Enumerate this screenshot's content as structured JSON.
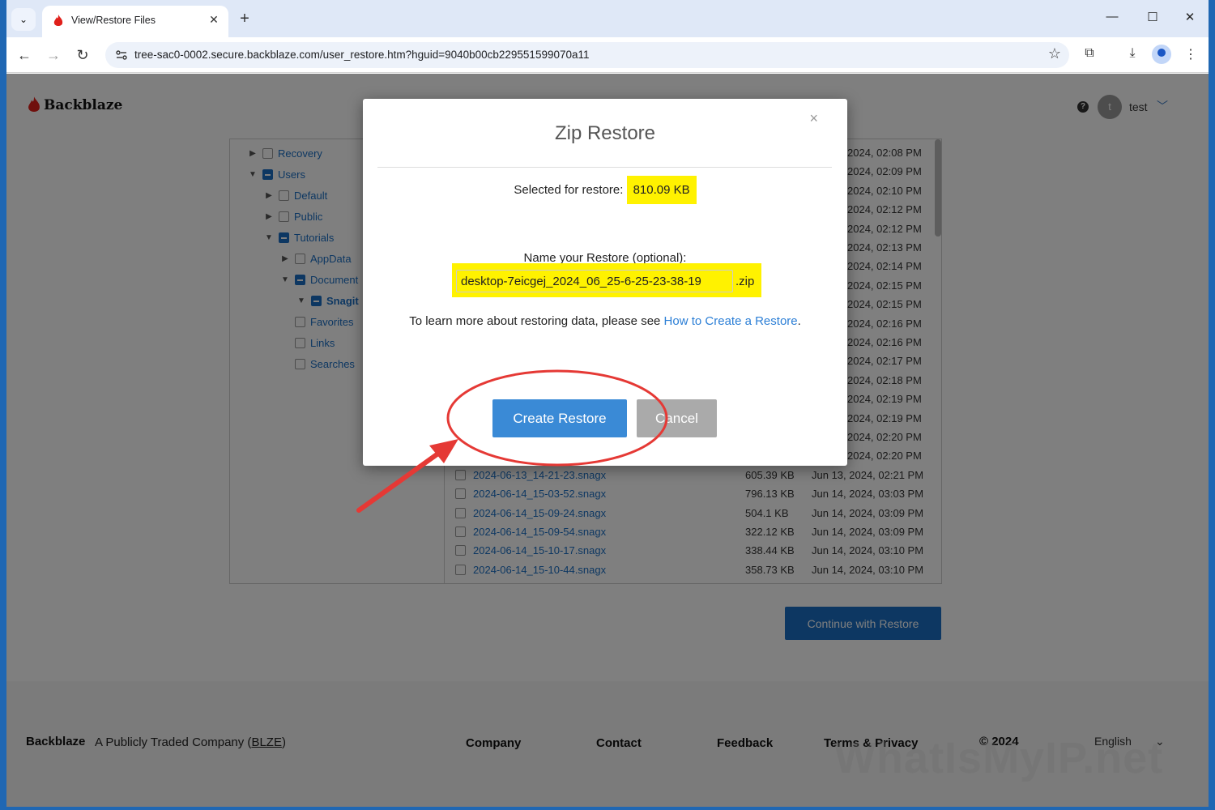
{
  "browser": {
    "tab_title": "View/Restore Files",
    "url": "tree-sac0-0002.secure.backblaze.com/user_restore.htm?hguid=9040b00cb229551599070a11",
    "window_controls": {
      "minimize": "—",
      "maximize": "☐",
      "close": "✕"
    }
  },
  "header": {
    "brand": "Backblaze",
    "help": "?",
    "avatar_letter": "t",
    "username": "test"
  },
  "tree": [
    {
      "label": "Recovery",
      "caret": "▶",
      "check": "none"
    },
    {
      "label": "Users",
      "caret": "▼",
      "check": "partial"
    },
    {
      "label": "Default",
      "caret": "▶",
      "check": "none"
    },
    {
      "label": "Public",
      "caret": "▶",
      "check": "none"
    },
    {
      "label": "Tutorials",
      "caret": "▼",
      "check": "partial"
    },
    {
      "label": "AppData",
      "caret": "▶",
      "check": "none"
    },
    {
      "label": "Document",
      "caret": "▼",
      "check": "partial"
    },
    {
      "label": "Snagit",
      "caret": "▼",
      "check": "partial"
    },
    {
      "label": "Favorites",
      "caret": "",
      "check": "none"
    },
    {
      "label": "Links",
      "caret": "",
      "check": "none"
    },
    {
      "label": "Searches",
      "caret": "",
      "check": "none"
    }
  ],
  "files": {
    "hidden_dates": [
      "2024, 02:08 PM",
      "2024, 02:09 PM",
      "2024, 02:10 PM",
      "2024, 02:12 PM",
      "2024, 02:12 PM",
      "2024, 02:13 PM",
      "2024, 02:14 PM",
      "2024, 02:15 PM",
      "2024, 02:15 PM",
      "2024, 02:16 PM",
      "2024, 02:16 PM",
      "2024, 02:17 PM",
      "2024, 02:18 PM",
      "2024, 02:19 PM",
      "2024, 02:19 PM",
      "2024, 02:20 PM",
      "2024, 02:20 PM"
    ],
    "visible_rows": [
      {
        "name": "2024-06-13_14-21-23.snagx",
        "size": "605.39 KB",
        "date": "Jun 13, 2024, 02:21 PM"
      },
      {
        "name": "2024-06-14_15-03-52.snagx",
        "size": "796.13 KB",
        "date": "Jun 14, 2024, 03:03 PM"
      },
      {
        "name": "2024-06-14_15-09-24.snagx",
        "size": "504.1 KB",
        "date": "Jun 14, 2024, 03:09 PM"
      },
      {
        "name": "2024-06-14_15-09-54.snagx",
        "size": "322.12 KB",
        "date": "Jun 14, 2024, 03:09 PM"
      },
      {
        "name": "2024-06-14_15-10-17.snagx",
        "size": "338.44 KB",
        "date": "Jun 14, 2024, 03:10 PM"
      },
      {
        "name": "2024-06-14_15-10-44.snagx",
        "size": "358.73 KB",
        "date": "Jun 14, 2024, 03:10 PM"
      }
    ]
  },
  "continue_label": "Continue with Restore",
  "modal": {
    "title": "Zip Restore",
    "close": "×",
    "selected_label": "Selected for restore:",
    "selected_size": "810.09 KB",
    "name_label": "Name your Restore (optional):",
    "name_value": "desktop-7eicgej_2024_06_25-6-25-23-38-19",
    "name_suffix": ".zip",
    "learn_prefix": "To learn more about restoring data, please see ",
    "learn_link": "How to Create a Restore",
    "learn_suffix": ".",
    "create_label": "Create Restore",
    "cancel_label": "Cancel"
  },
  "footer": {
    "brand": "Backblaze",
    "company_prefix": "A Publicly Traded Company (",
    "ticker": "BLZE",
    "company_suffix": ")",
    "links": [
      "Company",
      "Contact",
      "Feedback",
      "Terms & Privacy"
    ],
    "copyright": "© 2024",
    "language": "English"
  },
  "watermark": "WhatIsMyIP.net",
  "colors": {
    "accent": "#1b6fc4",
    "highlight": "#fff200",
    "annotation": "#e53935"
  }
}
